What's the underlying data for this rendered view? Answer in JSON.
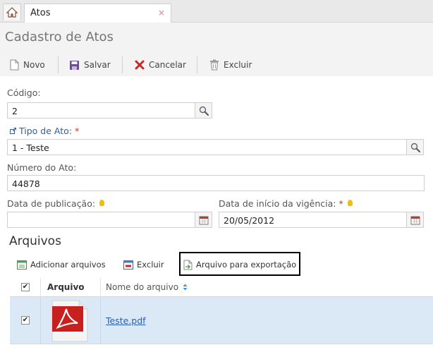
{
  "tabs": {
    "home_icon": "home-icon",
    "active_tab": "Atos",
    "close_glyph": "×"
  },
  "header": {
    "title": "Cadastro de Atos",
    "toolbar": {
      "novo": "Novo",
      "salvar": "Salvar",
      "cancelar": "Cancelar",
      "excluir": "Excluir"
    }
  },
  "form": {
    "codigo": {
      "label": "Código:",
      "value": "2"
    },
    "tipo_ato": {
      "label": "Tipo de Ato:",
      "required": "*",
      "value": "1 - Teste"
    },
    "numero_ato": {
      "label": "Número do Ato:",
      "value": "44878"
    },
    "data_publicacao": {
      "label": "Data de publicação:",
      "value": ""
    },
    "data_vigencia": {
      "label": "Data de início da vigência:",
      "required": "*",
      "value": "20/05/2012"
    }
  },
  "arquivos": {
    "title": "Arquivos",
    "toolbar": {
      "adicionar": "Adicionar arquivos",
      "excluir": "Excluir",
      "exportacao": "Arquivo para exportação"
    },
    "columns": {
      "arquivo": "Arquivo",
      "nome": "Nome do arquivo"
    },
    "rows": [
      {
        "checked": true,
        "filename": "Teste.pdf",
        "icon": "pdf-file-icon"
      }
    ]
  },
  "colors": {
    "header_bg": "#f3f3f3",
    "row_selected_bg": "#dbe9f7",
    "link": "#2a5db0",
    "required": "#c0392b"
  }
}
